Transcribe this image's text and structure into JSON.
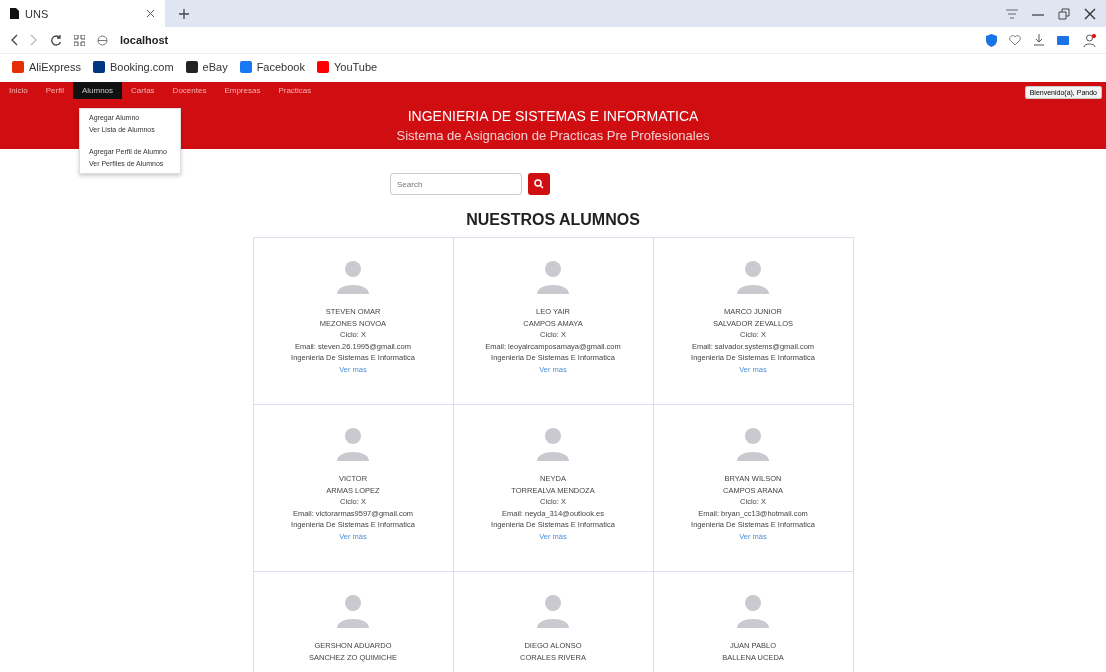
{
  "browser": {
    "tab_title": "UNS",
    "url": "localhost",
    "bookmarks": [
      {
        "label": "AliExpress",
        "color": "#e62e04"
      },
      {
        "label": "Booking.com",
        "color": "#003580"
      },
      {
        "label": "eBay",
        "color": "#222222"
      },
      {
        "label": "Facebook",
        "color": "#1877f2"
      },
      {
        "label": "YouTube",
        "color": "#ff0000"
      }
    ]
  },
  "nav": {
    "items": [
      {
        "label": "Inicio",
        "selected": false
      },
      {
        "label": "Perfil",
        "selected": false
      },
      {
        "label": "Alumnos",
        "selected": true
      },
      {
        "label": "Cartas",
        "selected": false
      },
      {
        "label": "Docentes",
        "selected": false
      },
      {
        "label": "Empresas",
        "selected": false
      },
      {
        "label": "Practicas",
        "selected": false
      }
    ],
    "dropdown": [
      [
        "Agregar Alumno",
        "Ver Lista de Alumnos"
      ],
      [
        "Agregar Perfil de Alumno",
        "Ver Perfiles de Alumnos"
      ]
    ],
    "user_button": "Bienvenido(a), Pando"
  },
  "header": {
    "title": "INGENIERIA DE SISTEMAS E INFORMATICA",
    "subtitle": "Sistema de Asignacion de Practicas Pre Profesionales"
  },
  "search": {
    "placeholder": "Search"
  },
  "heading": "NUESTROS ALUMNOS",
  "students": [
    {
      "first": "STEVEN OMAR",
      "last": "MEZONES NOVOA",
      "ciclo": "Ciclo: X",
      "email": "Email: steven.26.1995@gmail.com",
      "career": "Ingenieria De Sistemas E Informatica",
      "link": "Ver mas"
    },
    {
      "first": "LEO YAIR",
      "last": "CAMPOS AMAYA",
      "ciclo": "Ciclo: X",
      "email": "Email: leoyaircamposamaya@gmail.com",
      "career": "Ingenieria De Sistemas E Informatica",
      "link": "Ver mas"
    },
    {
      "first": "MARCO JUNIOR",
      "last": "SALVADOR ZEVALLOS",
      "ciclo": "Ciclo: X",
      "email": "Email: salvador.systems@gmail.com",
      "career": "Ingenieria De Sistemas E Informatica",
      "link": "Ver mas"
    },
    {
      "first": "VICTOR",
      "last": "ARMAS LOPEZ",
      "ciclo": "Ciclo: X",
      "email": "Email: victorarmas9597@gmail.com",
      "career": "Ingenieria De Sistemas E Informatica",
      "link": "Ver más"
    },
    {
      "first": "NEYDA",
      "last": "TORREALVA MENDOZA",
      "ciclo": "Ciclo: X",
      "email": "Email: neyda_314@outlook.es",
      "career": "Ingenieria De Sistemas E Informatica",
      "link": "Ver más"
    },
    {
      "first": "BRYAN WILSON",
      "last": "CAMPOS ARANA",
      "ciclo": "Ciclo: X",
      "email": "Email: bryan_cc13@hotmail.com",
      "career": "Ingenieria De Sistemas E Informatica",
      "link": "Ver más"
    },
    {
      "first": "GERSHON ADUARDO",
      "last": "SANCHEZ ZO QUIMICHE"
    },
    {
      "first": "DIEGO ALONSO",
      "last": "CORALES RIVERA"
    },
    {
      "first": "JUAN PABLO",
      "last": "BALLENA UCEDA"
    }
  ]
}
